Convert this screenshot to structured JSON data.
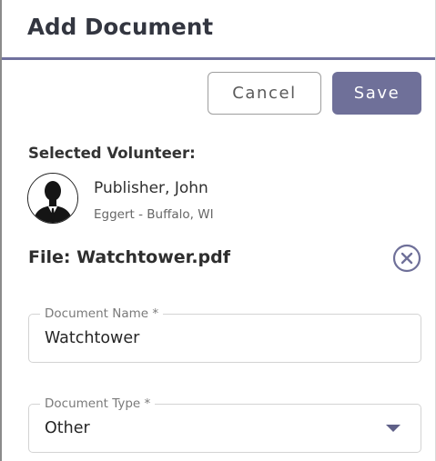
{
  "header": {
    "title": "Add Document"
  },
  "actions": {
    "cancel_label": "Cancel",
    "save_label": "Save"
  },
  "volunteer": {
    "section_label": "Selected Volunteer:",
    "name": "Publisher, John",
    "subtitle": "Eggert - Buffalo, WI",
    "avatar_icon": "person-silhouette-icon"
  },
  "file": {
    "label": "File: Watchtower.pdf",
    "remove_icon": "close-circle-icon"
  },
  "form": {
    "document_name": {
      "label": "Document Name *",
      "value": "Watchtower"
    },
    "document_type": {
      "label": "Document Type *",
      "value": "Other",
      "icon": "caret-down-icon"
    }
  },
  "colors": {
    "accent": "#6f7099",
    "header_rule": "#70719e",
    "field_border": "#d3d3d3"
  }
}
